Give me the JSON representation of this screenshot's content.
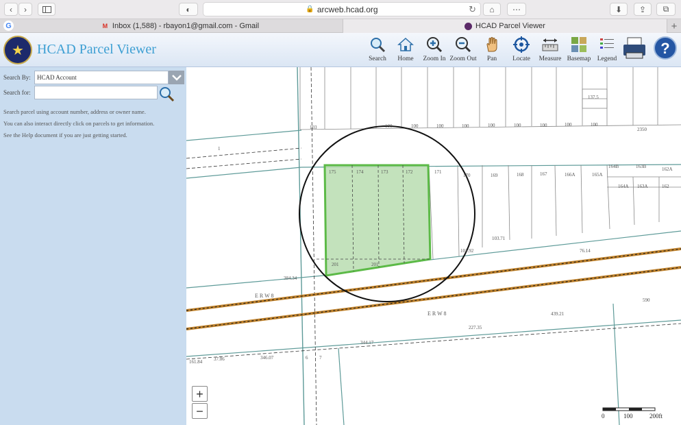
{
  "browser": {
    "url": "arcweb.hcad.org",
    "tabs": [
      {
        "label": "Inbox (1,588) - rbayon1@gmail.com - Gmail",
        "favicon": "M"
      },
      {
        "label": "HCAD Parcel Viewer",
        "active": true
      }
    ],
    "new_tab": "+"
  },
  "app": {
    "title": "HCAD Parcel Viewer",
    "toolbar": {
      "search": "Search",
      "home": "Home",
      "zoom_in": "Zoom In",
      "zoom_out": "Zoom Out",
      "pan": "Pan",
      "locate": "Locate",
      "measure": "Measure",
      "basemap": "Basemap",
      "legend": "Legend"
    }
  },
  "sidebar": {
    "search_by_label": "Search By:",
    "search_by_value": "HCAD Account",
    "search_for_label": "Search for:",
    "search_for_value": "",
    "help_lines": [
      "Search parcel using account number, address or owner name.",
      "You can also interact directly click on parcels to get information.",
      "See the Help document if you are just getting started."
    ]
  },
  "map": {
    "zoom_in": "+",
    "zoom_out": "−",
    "scale_labels": [
      "0",
      "100",
      "200ft"
    ],
    "street_labels": [
      "E R W 8",
      "E R W 8"
    ],
    "lot_numbers_top": [
      "103",
      "100",
      "100",
      "100",
      "100",
      "100",
      "100",
      "100",
      "100",
      "100",
      "2350"
    ],
    "lot_numbers_mid": [
      "175",
      "174",
      "173",
      "172",
      "171",
      "170",
      "169",
      "168",
      "167",
      "166A",
      "165A",
      "164B",
      "163B",
      "162A",
      "164A",
      "163A",
      "162"
    ],
    "dimension_labels": [
      "201",
      "201",
      "384.34",
      "439.21",
      "227.35",
      "344.17",
      "346.07",
      "161.84",
      "37.06",
      "590",
      "81.99",
      "235.43",
      "350.41",
      "328.91",
      "300.23",
      "290.06",
      "282.27",
      "288.43",
      "193.73",
      "101.92",
      "76.14",
      "103.71",
      "1",
      "6",
      "7",
      "6.3",
      "137.5",
      "240"
    ],
    "selected_parcel": "highlighted green parcel, lots 172–175",
    "colors": {
      "parcel_fill": "#b9ddb0",
      "parcel_stroke": "#5cba47",
      "railroad": "#c1822a",
      "parcel_lines": "#5d9a98"
    }
  }
}
